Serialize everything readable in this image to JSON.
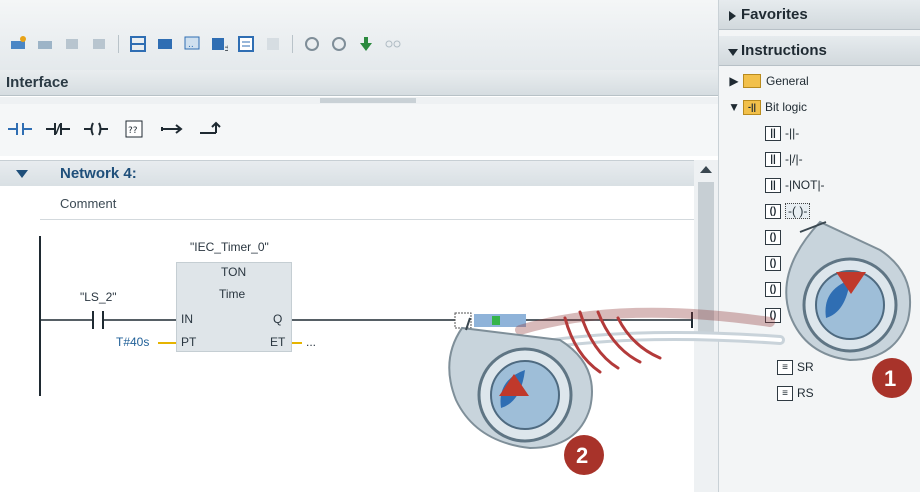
{
  "editor": {
    "interface_label": "Interface",
    "network": {
      "title": "Network 4:",
      "comment": "Comment"
    },
    "ladder": {
      "timer_instance": "\"IEC_Timer_0\"",
      "timer_type": "TON",
      "timer_data_type": "Time",
      "contact_tag": "\"LS_2\"",
      "pin_in": "IN",
      "pin_pt": "PT",
      "pin_q": "Q",
      "pin_et": "ET",
      "pt_value": "T#40s",
      "et_value": "..."
    }
  },
  "panel": {
    "favorites": "Favorites",
    "instructions": "Instructions",
    "tree": [
      {
        "label": "General",
        "icon": "folder-icon",
        "expanded": false
      },
      {
        "label": "Bit logic",
        "icon": "bit-logic-icon",
        "expanded": true
      },
      {
        "label": "-||-",
        "icon": "no-contact-icon"
      },
      {
        "label": "-|/|-",
        "icon": "nc-contact-icon"
      },
      {
        "label": "-|NOT|-",
        "icon": "not-contact-icon"
      },
      {
        "label": "-( )-",
        "icon": "coil-icon",
        "highlighted": true
      },
      {
        "label": "SR",
        "icon": "sr-flipflop-icon"
      },
      {
        "label": "RS",
        "icon": "rs-flipflop-icon"
      }
    ]
  },
  "callouts": {
    "step1": "1",
    "step2": "2"
  },
  "colors": {
    "network_title": "#1f4f7a",
    "tag_blue": "#1f5f97",
    "callout_red": "#c0392b",
    "tree_folder": "#f2c04a"
  }
}
